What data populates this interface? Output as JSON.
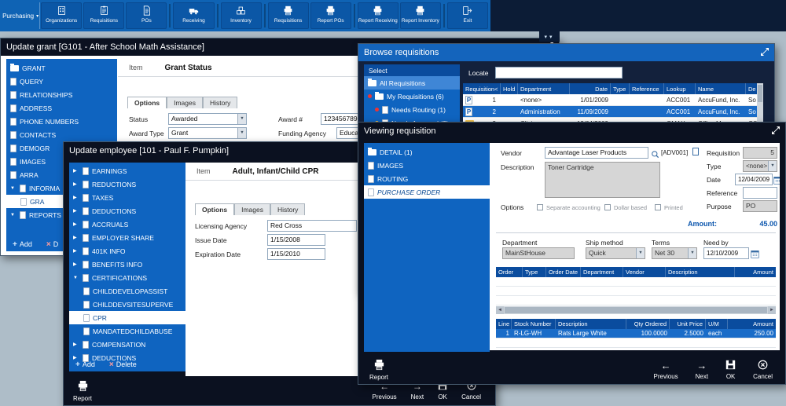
{
  "toolbar": {
    "menu_label": "Purchasing",
    "buttons": [
      {
        "label": "Organizations"
      },
      {
        "label": "Requisitions"
      },
      {
        "label": "POs"
      },
      {
        "label": "Receiving"
      },
      {
        "label": "Inventory"
      },
      {
        "label": "Requisitions"
      },
      {
        "label": "Report POs"
      },
      {
        "label": "Report Receiving"
      },
      {
        "label": "Report Inventory"
      },
      {
        "label": "Exit"
      }
    ]
  },
  "grant": {
    "title": "Update grant [G101 - After School Math Assistance]",
    "item_label": "Item",
    "item_value": "Grant Status",
    "tabs": [
      "Options",
      "Images",
      "History"
    ],
    "tree": [
      "GRANT",
      "QUERY",
      "RELATIONSHIPS",
      "ADDRESS",
      "PHONE NUMBERS",
      "CONTACTS",
      "DEMOGR",
      "IMAGES",
      "ARRA",
      "INFORMA",
      "GRA",
      "REPORTS"
    ],
    "add_label": "Add",
    "delete_label": "D",
    "fields": {
      "status_label": "Status",
      "status_value": "Awarded",
      "award_type_label": "Award Type",
      "award_type_value": "Grant",
      "award_number_label": "Award #",
      "award_number_value": "123456789",
      "funding_agency_label": "Funding Agency",
      "funding_agency_value": "Education"
    }
  },
  "employee": {
    "title": "Update employee [101 - Paul F. Pumpkin]",
    "item_label": "Item",
    "item_value": "Adult, Infant/Child CPR",
    "tabs": [
      "Options",
      "Images",
      "History"
    ],
    "tree": [
      "EARNINGS",
      "REDUCTIONS",
      "TAXES",
      "DEDUCTIONS",
      "ACCRUALS",
      "EMPLOYER SHARE",
      "401K INFO",
      "BENEFITS INFO",
      "CERTIFICATIONS",
      "COMPENSATION",
      "DEDUCTIONS"
    ],
    "children": [
      "CHILDDEVELOPASSIST",
      "CHILDDEVSITESUPERVE",
      "CPR",
      "MANDATEDCHILDABUSE"
    ],
    "add_label": "Add",
    "delete_label": "Delete",
    "fields": {
      "agency_label": "Licensing Agency",
      "agency_value": "Red Cross",
      "issue_label": "Issue Date",
      "issue_value": "1/15/2008",
      "expiration_label": "Expiration Date",
      "expiration_value": "1/15/2010"
    },
    "footer": {
      "report": "Report",
      "previous": "Previous",
      "next": "Next",
      "ok": "OK",
      "cancel": "Cancel"
    }
  },
  "browse": {
    "title": "Browse requisitions",
    "select_label": "Select",
    "locate_label": "Locate",
    "locate_value": "",
    "tree": [
      "All Requisitions",
      "My Requisitions (6)",
      "Needs Routing (1)",
      "Needs Approval (3)"
    ],
    "columns": [
      "Requisition<",
      "Hold",
      "Department",
      "Date",
      "Type",
      "Reference",
      "Lookup",
      "Name",
      "De"
    ],
    "rows": [
      {
        "req": "1",
        "hold": "",
        "dept": "<none>",
        "date": "1/01/2009",
        "type": "",
        "ref": "",
        "lookup": "ACC001",
        "name": "AccuFund, Inc.",
        "de": "So"
      },
      {
        "req": "2",
        "hold": "",
        "dept": "Administration",
        "date": "11/09/2009",
        "type": "",
        "ref": "",
        "lookup": "ACC001",
        "name": "AccuFund, Inc.",
        "de": "So"
      },
      {
        "req": "3",
        "hold": "",
        "dept": "Clinic",
        "date": "12/04/2009",
        "type": "",
        "ref": "",
        "lookup": "OMAX",
        "name": "Office Max",
        "de": "Off"
      }
    ]
  },
  "viewing": {
    "title": "Viewing requisition",
    "nav": [
      "DETAIL (1)",
      "IMAGES",
      "ROUTING",
      "PURCHASE ORDER"
    ],
    "form": {
      "vendor_label": "Vendor",
      "vendor_value": "Advantage Laser Products",
      "vendor_code": "[ADV001]",
      "requisition_label": "Requisition",
      "requisition_value": "5",
      "description_label": "Description",
      "description_value": "Toner Cartridge",
      "type_label": "Type",
      "type_value": "<none>",
      "date_label": "Date",
      "date_value": "12/04/2009",
      "reference_label": "Reference",
      "reference_value": "",
      "options_label": "Options",
      "opt_separate": "Separate accounting",
      "opt_dollar": "Dollar based",
      "opt_printed": "Printed",
      "purpose_label": "Purpose",
      "purpose_value": "PO",
      "amount_label": "Amount:",
      "amount_value": "45.00",
      "department_label": "Department",
      "department_value": "MainStHouse",
      "ship_method_label": "Ship method",
      "ship_method_value": "Quick",
      "terms_label": "Terms",
      "terms_value": "Net 30",
      "need_by_label": "Need by",
      "need_by_value": "12/10/2009"
    },
    "orders_columns": [
      "Order",
      "Type",
      "Order Date",
      "Department",
      "Vendor",
      "Description",
      "Amount"
    ],
    "lines_columns": [
      "Line",
      "Stock Number",
      "Description",
      "Qty Ordered",
      "Unit Price",
      "U/M",
      "Amount"
    ],
    "line": {
      "line": "1",
      "stock": "R-LG-WH",
      "desc": "Rats Large White",
      "qty": "100.0000",
      "price": "2.5000",
      "um": "each",
      "amount": "250.00"
    },
    "footer": {
      "report": "Report",
      "previous": "Previous",
      "next": "Next",
      "ok": "OK",
      "cancel": "Cancel"
    }
  }
}
